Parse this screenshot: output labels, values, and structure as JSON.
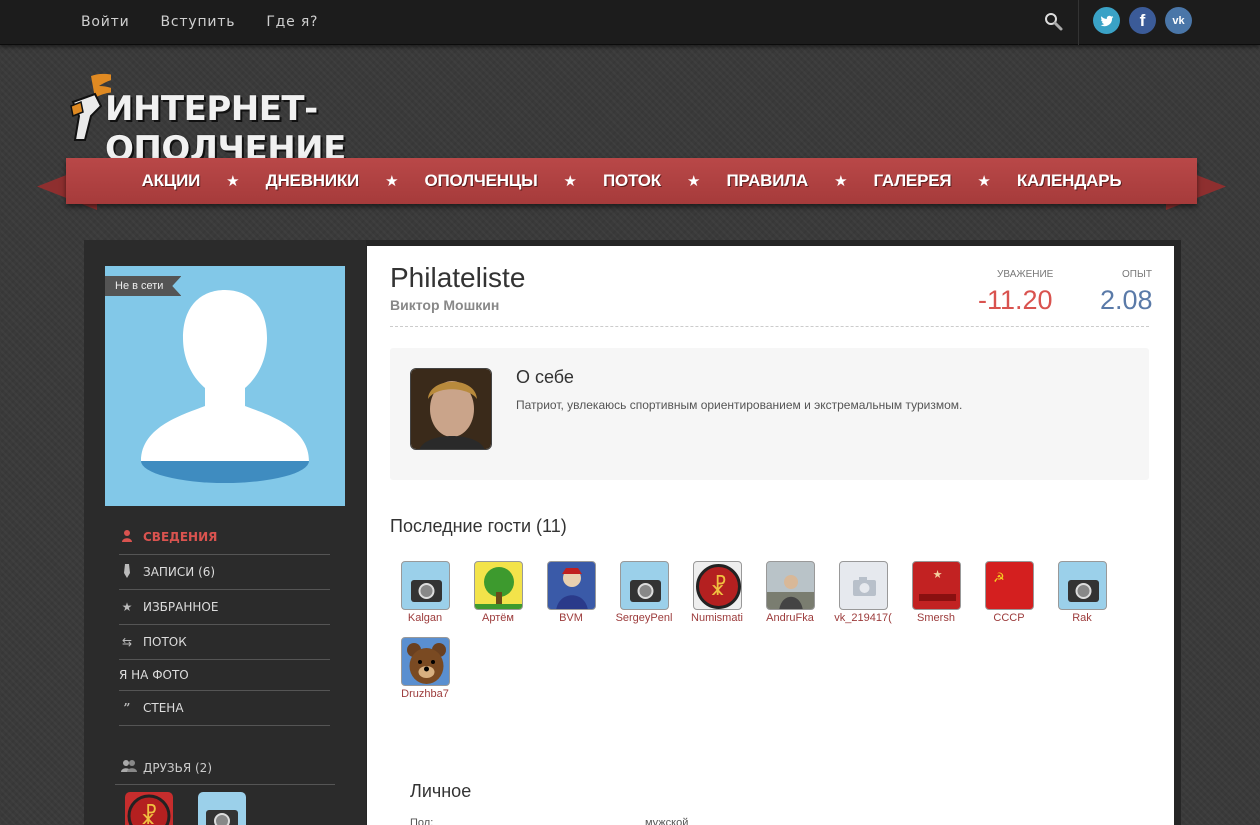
{
  "topnav": {
    "login": "Войти",
    "register": "Вступить",
    "where": "Где я?"
  },
  "logo": {
    "text": "ИНТЕРНЕТ-ОПОЛЧЕНИЕ"
  },
  "mainnav": [
    "АКЦИИ",
    "ДНЕВНИКИ",
    "ОПОЛЧЕНЦЫ",
    "ПОТОК",
    "ПРАВИЛА",
    "ГАЛЕРЕЯ",
    "КАЛЕНДАРЬ"
  ],
  "star": "★",
  "profile": {
    "status": "Не в сети",
    "username": "Philateliste",
    "realname": "Виктор Мошкин",
    "respect_label": "УВАЖЕНИЕ",
    "respect_value": "-11.20",
    "experience_label": "ОПЫТ",
    "experience_value": "2.08"
  },
  "sidebar": {
    "items": [
      {
        "label": "СВЕДЕНИЯ",
        "icon": "user-icon"
      },
      {
        "label": "ЗАПИСИ (6)",
        "icon": "pen-icon"
      },
      {
        "label": "ИЗБРАННОЕ",
        "icon": "star-icon"
      },
      {
        "label": "ПОТОК",
        "icon": "retweet-icon"
      },
      {
        "label": "Я НА ФОТО",
        "icon": ""
      },
      {
        "label": "СТЕНА",
        "icon": "quote-icon"
      }
    ],
    "friends_title": "ДРУЗЬЯ (2)"
  },
  "about": {
    "title": "О себе",
    "text": "Патриот, увлекаюсь спортивным ориентированием и экстремальным туризмом."
  },
  "guests": {
    "title": "Последние гости (11)",
    "items": [
      "Kalgan",
      "Артём",
      "BVM",
      "SergeyPenl",
      "Numismati",
      "AndruFka",
      "vk_219417(",
      "Smersh",
      "СССР",
      "Rak",
      "Druzhba7"
    ]
  },
  "personal": {
    "title": "Личное",
    "gender_label": "Пол:",
    "gender_value": "мужской"
  },
  "colors": {
    "ribbon": "#b04242",
    "respect": "#d9534f",
    "experience": "#5a7aa8",
    "avatar_bg": "#82c8e8"
  }
}
